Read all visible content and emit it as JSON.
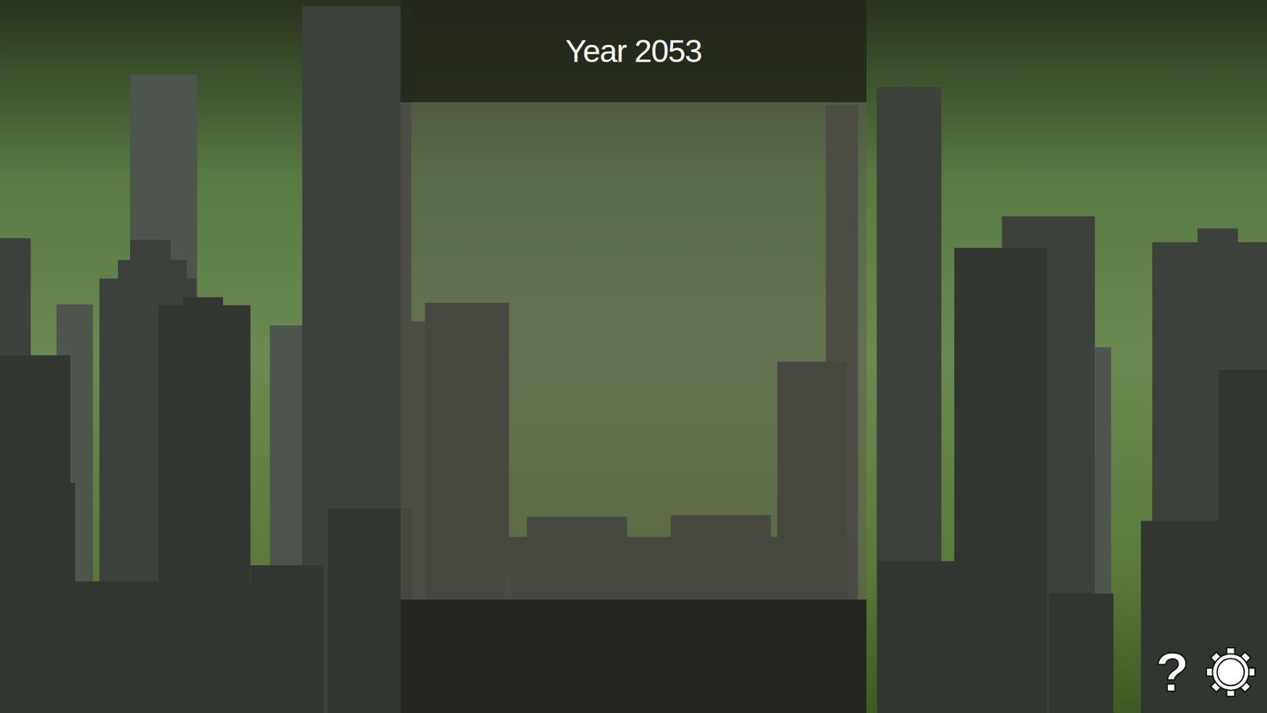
{
  "hud": {
    "year": "Year 2053"
  },
  "help_button": {
    "label": "?"
  }
}
